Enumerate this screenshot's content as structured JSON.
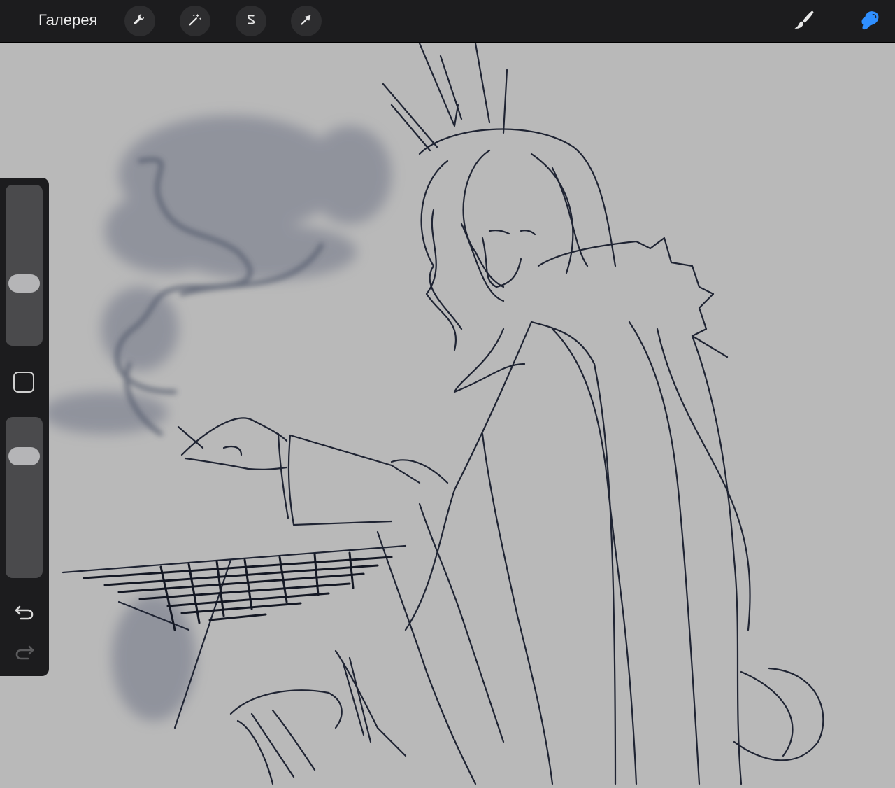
{
  "header": {
    "gallery_label": "Галерея",
    "tools_left": [
      "wrench-icon",
      "magic-wand-icon",
      "selection-s-icon",
      "transform-arrow-icon"
    ],
    "tools_right": [
      "brush-icon",
      "smudge-icon"
    ],
    "accent_color": "#2f8fff"
  },
  "sidebar": {
    "brush_size_level": 0.38,
    "opacity_level": 0.22,
    "modify_button_icon": "square-icon",
    "undo_icon": "undo-icon",
    "redo_icon": "redo-icon"
  },
  "canvas": {
    "background_color": "#b9b9b9",
    "content": "sketch-artwork"
  }
}
